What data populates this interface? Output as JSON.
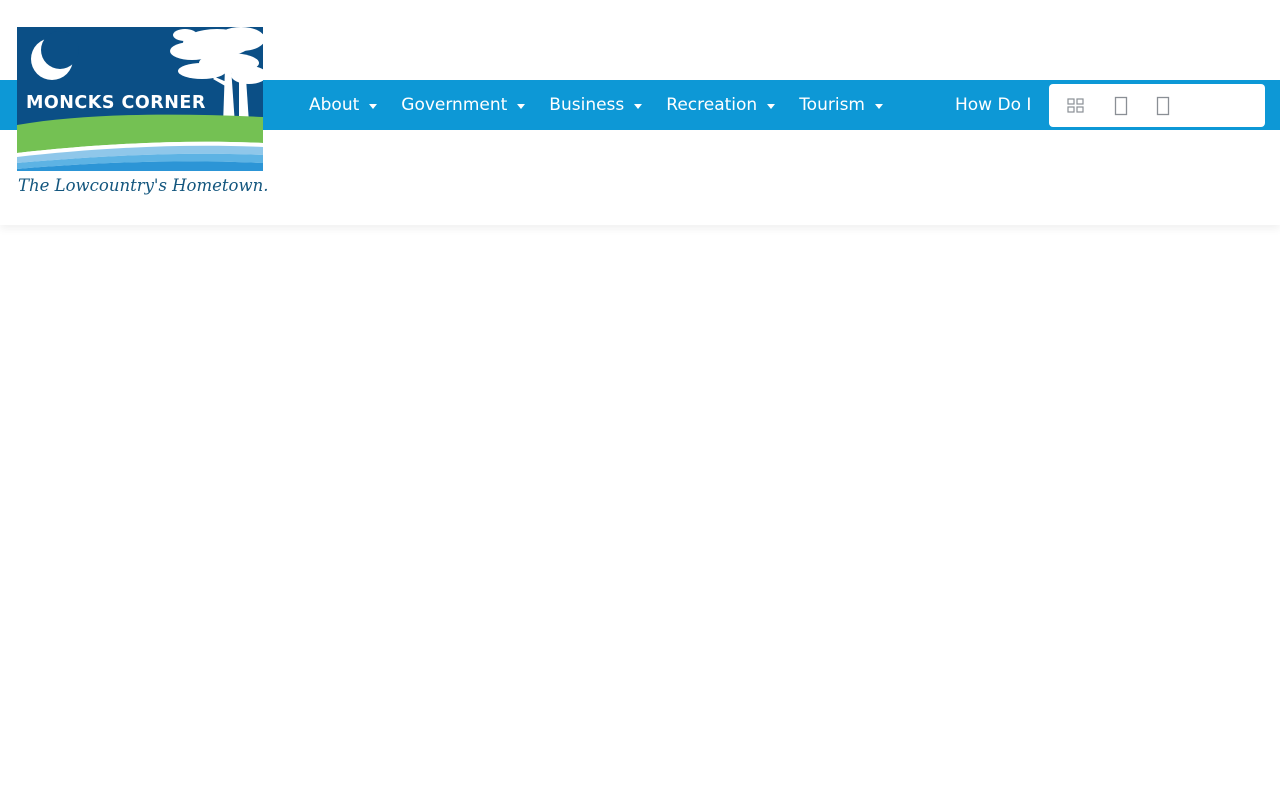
{
  "logo": {
    "title": "MONCKS CORNER",
    "tagline": "The Lowcountry's Hometown."
  },
  "nav": {
    "items": [
      {
        "label": "About"
      },
      {
        "label": "Government"
      },
      {
        "label": "Business"
      },
      {
        "label": "Recreation"
      },
      {
        "label": "Tourism"
      },
      {
        "label": "How Do I"
      }
    ]
  },
  "tools": {
    "icons": [
      "grid-icon",
      "tool-icon-2",
      "tool-icon-3"
    ]
  },
  "colors": {
    "nav_background": "#0d98d6",
    "logo_navy": "#0b4f86",
    "logo_green": "#74c153",
    "logo_water": "#3a9fdc",
    "tagline": "#13567e",
    "header_background": "#ffffff"
  }
}
